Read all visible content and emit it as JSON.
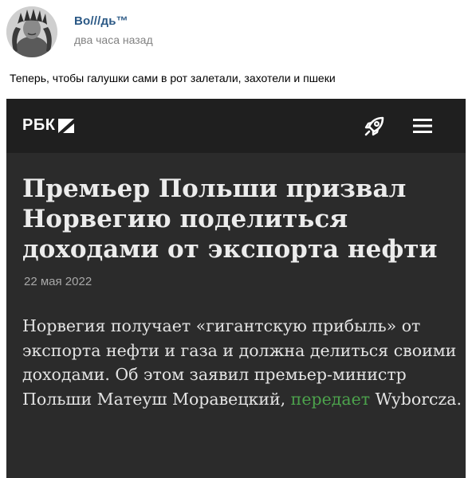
{
  "post": {
    "author": "Во///дь™",
    "time": "два часа назад",
    "text": "Теперь, чтобы галушки сами в рот залетали, захотели и пшеки"
  },
  "article": {
    "site_logo": "РБК",
    "headline": "Премьер Польши призвал Норвегию поделиться доходами от экспорта нефти",
    "date": "22 мая 2022",
    "lead_before_link": "Норвегия получает «гигантскую прибыль» от экспорта нефти и газа и должна делиться своими доходами. Об этом заявил премьер-министр Польши Матеуш Моравецкий, ",
    "lead_link": "передает",
    "lead_after_link": " Wyborcza.",
    "icons": {
      "logo_mark": "rbk-logo-mark-icon",
      "rocket": "rocket-icon",
      "menu": "hamburger-menu-icon"
    }
  },
  "colors": {
    "author_link": "#2a5885",
    "screenshot_bg": "#2b2b2b",
    "topbar_bg": "#1f1f1f",
    "article_link": "#4ca24c"
  }
}
